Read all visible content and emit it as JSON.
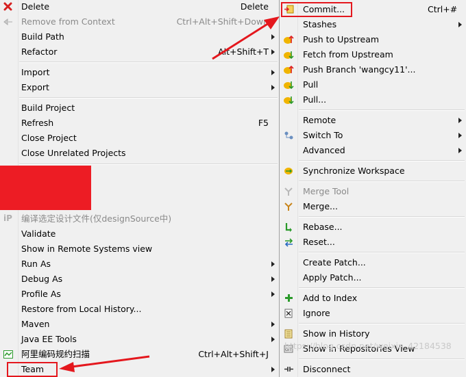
{
  "left_menu": {
    "items": [
      {
        "label": "Delete",
        "shortcut": "Delete",
        "icon": "delete-icon"
      },
      {
        "label": "Remove from Context",
        "shortcut": "Ctrl+Alt+Shift+Down",
        "disabled": true,
        "icon": "remove-context-icon"
      },
      {
        "label": "Build Path",
        "submenu": true
      },
      {
        "label": "Refactor",
        "shortcut": "Alt+Shift+T",
        "submenu": true
      },
      {
        "label": "Import",
        "submenu": true,
        "icon": "import-icon"
      },
      {
        "label": "Export",
        "submenu": true,
        "icon": "export-icon"
      },
      {
        "label": "Build Project"
      },
      {
        "label": "Refresh",
        "shortcut": "F5"
      },
      {
        "label": "Close Project"
      },
      {
        "label": "Close Unrelated Projects"
      },
      {
        "label": "编译选定设计文件(仅designSource中)",
        "disabled": true,
        "icon": "ip-icon"
      },
      {
        "label": "Validate"
      },
      {
        "label": "Show in Remote Systems view"
      },
      {
        "label": "Run As",
        "submenu": true
      },
      {
        "label": "Debug As",
        "submenu": true
      },
      {
        "label": "Profile As",
        "submenu": true
      },
      {
        "label": "Restore from Local History..."
      },
      {
        "label": "Maven",
        "submenu": true
      },
      {
        "label": "Java EE Tools",
        "submenu": true
      },
      {
        "label": "阿里编码规约扫描",
        "shortcut": "Ctrl+Alt+Shift+J",
        "icon": "code-scan-icon"
      },
      {
        "label": "Team",
        "submenu": true
      }
    ]
  },
  "right_menu": {
    "items": [
      {
        "label": "Commit...",
        "shortcut": "Ctrl+#",
        "icon": "commit-icon"
      },
      {
        "label": "Stashes",
        "submenu": true
      },
      {
        "label": "Push to Upstream",
        "icon": "push-icon"
      },
      {
        "label": "Fetch from Upstream",
        "icon": "fetch-icon"
      },
      {
        "label": "Push Branch 'wangcy11'...",
        "icon": "push-branch-icon"
      },
      {
        "label": "Pull",
        "icon": "pull-icon"
      },
      {
        "label": "Pull...",
        "icon": "pull-dialog-icon"
      },
      {
        "label": "Remote",
        "submenu": true
      },
      {
        "label": "Switch To",
        "submenu": true,
        "icon": "switch-icon"
      },
      {
        "label": "Advanced",
        "submenu": true
      },
      {
        "label": "Synchronize Workspace",
        "icon": "sync-icon"
      },
      {
        "label": "Merge Tool",
        "disabled": true,
        "icon": "merge-tool-icon"
      },
      {
        "label": "Merge...",
        "icon": "merge-icon"
      },
      {
        "label": "Rebase...",
        "icon": "rebase-icon"
      },
      {
        "label": "Reset...",
        "icon": "reset-icon"
      },
      {
        "label": "Create Patch..."
      },
      {
        "label": "Apply Patch..."
      },
      {
        "label": "Add to Index",
        "icon": "add-index-icon"
      },
      {
        "label": "Ignore",
        "icon": "ignore-icon"
      },
      {
        "label": "Show in History",
        "icon": "history-icon"
      },
      {
        "label": "Show in Repositories View",
        "icon": "repositories-icon"
      },
      {
        "label": "Disconnect",
        "icon": "disconnect-icon"
      }
    ]
  },
  "watermark": "https://blog.csdn.net/weixin_42184538",
  "colors": {
    "annotation_red": "#e4171d",
    "menu_bg": "#f0f0f0"
  }
}
